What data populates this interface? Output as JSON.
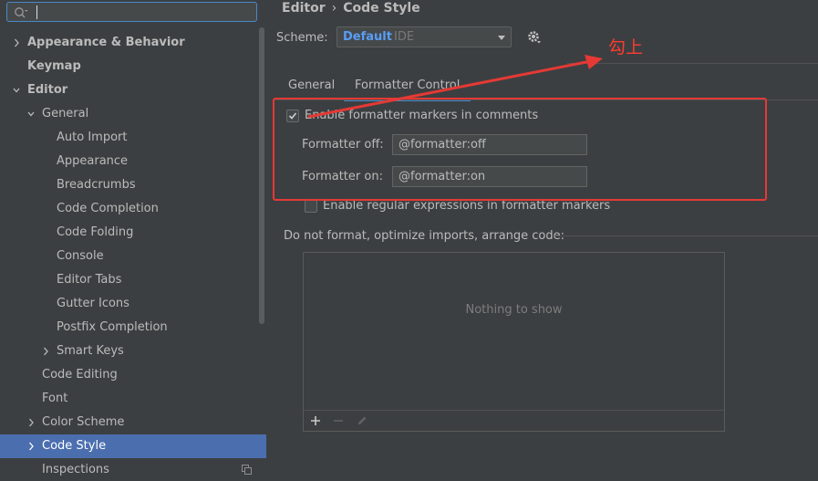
{
  "search": {
    "value": "",
    "placeholder": ""
  },
  "sidebar": {
    "items": [
      {
        "label": "Appearance & Behavior",
        "bold": true,
        "expandable": "collapsed"
      },
      {
        "label": "Keymap",
        "bold": true
      },
      {
        "label": "Editor",
        "bold": true,
        "expandable": "expanded"
      },
      {
        "label": "General",
        "expandable": "expanded"
      },
      {
        "label": "Auto Import"
      },
      {
        "label": "Appearance"
      },
      {
        "label": "Breadcrumbs"
      },
      {
        "label": "Code Completion"
      },
      {
        "label": "Code Folding"
      },
      {
        "label": "Console"
      },
      {
        "label": "Editor Tabs"
      },
      {
        "label": "Gutter Icons"
      },
      {
        "label": "Postfix Completion"
      },
      {
        "label": "Smart Keys",
        "expandable": "collapsed"
      },
      {
        "label": "Code Editing"
      },
      {
        "label": "Font"
      },
      {
        "label": "Color Scheme",
        "expandable": "collapsed"
      },
      {
        "label": "Code Style",
        "expandable": "collapsed",
        "selected": true
      },
      {
        "label": "Inspections",
        "icon": "copy-icon"
      }
    ]
  },
  "breadcrumb": {
    "parent": "Editor",
    "separator": "›",
    "current": "Code Style"
  },
  "scheme": {
    "label": "Scheme:",
    "value_bold": "Default",
    "value_suffix": "IDE"
  },
  "tabs": [
    {
      "label": "General",
      "active": false
    },
    {
      "label": "Formatter Control",
      "active": true
    }
  ],
  "formatter": {
    "enable_markers_label": "Enable formatter markers in comments",
    "enable_markers_checked": true,
    "off_label": "Formatter off:",
    "off_value": "@formatter:off",
    "on_label": "Formatter on:",
    "on_value": "@formatter:on",
    "regex_label": "Enable regular expressions in formatter markers",
    "regex_checked": false
  },
  "do_not_format": {
    "title": "Do not format, optimize imports, arrange code:",
    "empty_text": "Nothing to show"
  },
  "annotation": {
    "text": "勾上",
    "color": "#e53935"
  },
  "colors": {
    "accent": "#4a88c7",
    "selection": "#4b6eaf",
    "scheme_default": "#589df6"
  }
}
